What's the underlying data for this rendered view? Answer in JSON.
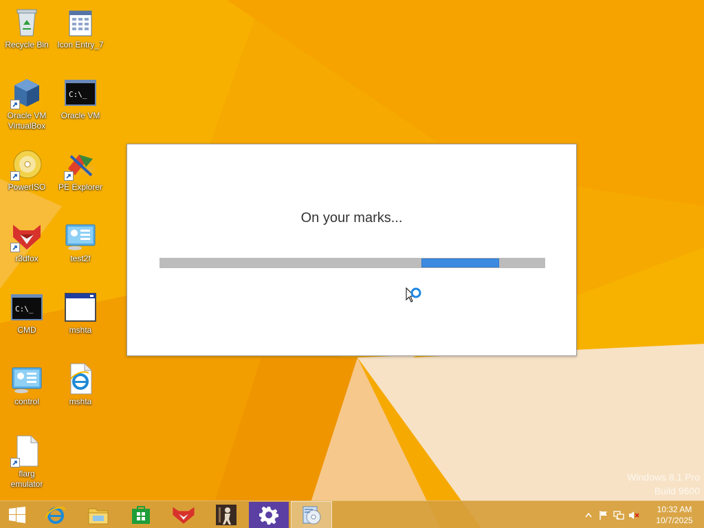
{
  "desktop": {
    "icons": [
      {
        "label": "Recycle Bin",
        "icon": "recycle-bin-icon"
      },
      {
        "label": "Icon Entry_7",
        "icon": "spreadsheet-icon"
      },
      {
        "label": "Oracle VM\nVirtualBox",
        "icon": "virtualbox-icon"
      },
      {
        "label": "Oracle VM",
        "icon": "console-icon"
      },
      {
        "label": "PowerISO",
        "icon": "disc-icon"
      },
      {
        "label": "PE Explorer",
        "icon": "pe-explorer-icon"
      },
      {
        "label": "r3dfox",
        "icon": "r3dfox-icon"
      },
      {
        "label": "test2f",
        "icon": "control-panel-icon"
      },
      {
        "label": "CMD",
        "icon": "console-icon"
      },
      {
        "label": "mshta",
        "icon": "window-icon"
      },
      {
        "label": "control",
        "icon": "control-panel-icon"
      },
      {
        "label": "mshta",
        "icon": "ie-document-icon"
      },
      {
        "label": "flarg\nemulator",
        "icon": "blank-file-icon"
      }
    ]
  },
  "splash": {
    "message": "On your marks...",
    "progress": {
      "chunk_start": 0.68,
      "chunk_end": 0.88,
      "indeterminate": true
    }
  },
  "watermark": {
    "line1": "Windows 8.1 Pro",
    "line2": "Build 9600"
  },
  "taskbar": {
    "apps": [
      {
        "icon": "internet-explorer-icon"
      },
      {
        "icon": "file-explorer-icon"
      },
      {
        "icon": "store-icon"
      },
      {
        "icon": "r3dfox-icon"
      },
      {
        "icon": "app-figure-icon"
      },
      {
        "icon": "settings-gear-icon"
      },
      {
        "icon": "setup-disc-icon",
        "active": true
      }
    ],
    "tray": {
      "icons": [
        "show-hidden-icon",
        "action-center-flag-icon",
        "network-icon",
        "volume-muted-icon"
      ],
      "time": "10:32 AM",
      "date": "10/7/2025"
    }
  },
  "colors": {
    "wallpaper": "#f5a800",
    "progress_chunk": "#3c8be0",
    "progress_track": "#bcbcbc"
  }
}
